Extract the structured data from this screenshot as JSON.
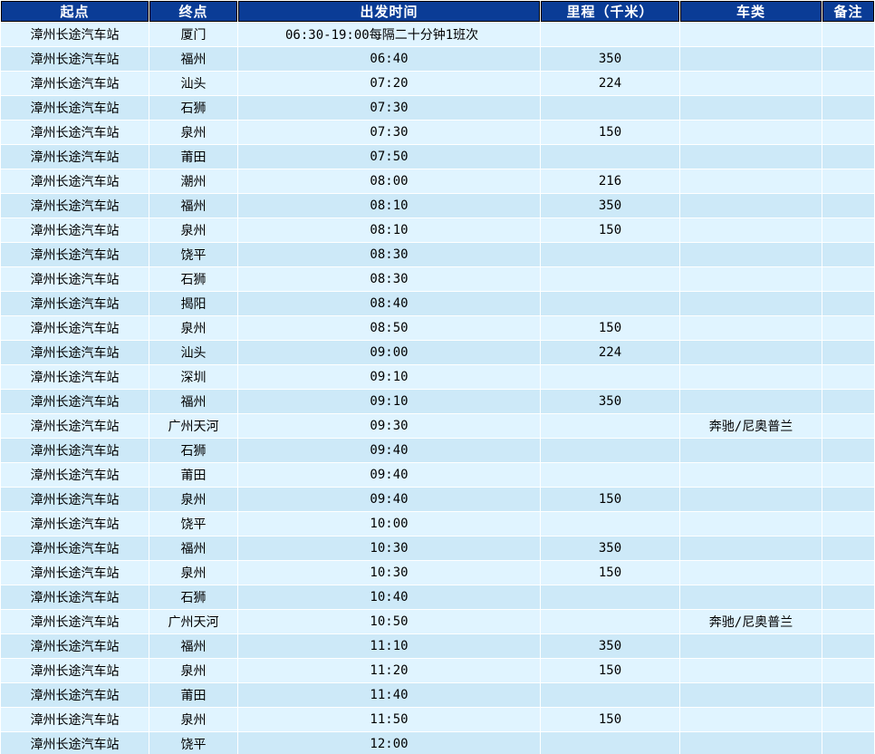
{
  "headers": {
    "origin": "起点",
    "destination": "终点",
    "departure": "出发时间",
    "distance": "里程（千米）",
    "bus_type": "车类",
    "remarks": "备注"
  },
  "rows": [
    {
      "origin": "漳州长途汽车站",
      "destination": "厦门",
      "departure": "06:30-19:00每隔二十分钟1班次",
      "distance": "",
      "bus_type": "",
      "remarks": ""
    },
    {
      "origin": "漳州长途汽车站",
      "destination": "福州",
      "departure": "06:40",
      "distance": "350",
      "bus_type": "",
      "remarks": ""
    },
    {
      "origin": "漳州长途汽车站",
      "destination": "汕头",
      "departure": "07:20",
      "distance": "224",
      "bus_type": "",
      "remarks": ""
    },
    {
      "origin": "漳州长途汽车站",
      "destination": "石狮",
      "departure": "07:30",
      "distance": "",
      "bus_type": "",
      "remarks": ""
    },
    {
      "origin": "漳州长途汽车站",
      "destination": "泉州",
      "departure": "07:30",
      "distance": "150",
      "bus_type": "",
      "remarks": ""
    },
    {
      "origin": "漳州长途汽车站",
      "destination": "莆田",
      "departure": "07:50",
      "distance": "",
      "bus_type": "",
      "remarks": ""
    },
    {
      "origin": "漳州长途汽车站",
      "destination": "潮州",
      "departure": "08:00",
      "distance": "216",
      "bus_type": "",
      "remarks": ""
    },
    {
      "origin": "漳州长途汽车站",
      "destination": "福州",
      "departure": "08:10",
      "distance": "350",
      "bus_type": "",
      "remarks": ""
    },
    {
      "origin": "漳州长途汽车站",
      "destination": "泉州",
      "departure": "08:10",
      "distance": "150",
      "bus_type": "",
      "remarks": ""
    },
    {
      "origin": "漳州长途汽车站",
      "destination": "饶平",
      "departure": "08:30",
      "distance": "",
      "bus_type": "",
      "remarks": ""
    },
    {
      "origin": "漳州长途汽车站",
      "destination": "石狮",
      "departure": "08:30",
      "distance": "",
      "bus_type": "",
      "remarks": ""
    },
    {
      "origin": "漳州长途汽车站",
      "destination": "揭阳",
      "departure": "08:40",
      "distance": "",
      "bus_type": "",
      "remarks": ""
    },
    {
      "origin": "漳州长途汽车站",
      "destination": "泉州",
      "departure": "08:50",
      "distance": "150",
      "bus_type": "",
      "remarks": ""
    },
    {
      "origin": "漳州长途汽车站",
      "destination": "汕头",
      "departure": "09:00",
      "distance": "224",
      "bus_type": "",
      "remarks": ""
    },
    {
      "origin": "漳州长途汽车站",
      "destination": "深圳",
      "departure": "09:10",
      "distance": "",
      "bus_type": "",
      "remarks": ""
    },
    {
      "origin": "漳州长途汽车站",
      "destination": "福州",
      "departure": "09:10",
      "distance": "350",
      "bus_type": "",
      "remarks": ""
    },
    {
      "origin": "漳州长途汽车站",
      "destination": "广州天河",
      "departure": "09:30",
      "distance": "",
      "bus_type": "奔驰/尼奥普兰",
      "remarks": ""
    },
    {
      "origin": "漳州长途汽车站",
      "destination": "石狮",
      "departure": "09:40",
      "distance": "",
      "bus_type": "",
      "remarks": ""
    },
    {
      "origin": "漳州长途汽车站",
      "destination": "莆田",
      "departure": "09:40",
      "distance": "",
      "bus_type": "",
      "remarks": ""
    },
    {
      "origin": "漳州长途汽车站",
      "destination": "泉州",
      "departure": "09:40",
      "distance": "150",
      "bus_type": "",
      "remarks": ""
    },
    {
      "origin": "漳州长途汽车站",
      "destination": "饶平",
      "departure": "10:00",
      "distance": "",
      "bus_type": "",
      "remarks": ""
    },
    {
      "origin": "漳州长途汽车站",
      "destination": "福州",
      "departure": "10:30",
      "distance": "350",
      "bus_type": "",
      "remarks": ""
    },
    {
      "origin": "漳州长途汽车站",
      "destination": "泉州",
      "departure": "10:30",
      "distance": "150",
      "bus_type": "",
      "remarks": ""
    },
    {
      "origin": "漳州长途汽车站",
      "destination": "石狮",
      "departure": "10:40",
      "distance": "",
      "bus_type": "",
      "remarks": ""
    },
    {
      "origin": "漳州长途汽车站",
      "destination": "广州天河",
      "departure": "10:50",
      "distance": "",
      "bus_type": "奔驰/尼奥普兰",
      "remarks": ""
    },
    {
      "origin": "漳州长途汽车站",
      "destination": "福州",
      "departure": "11:10",
      "distance": "350",
      "bus_type": "",
      "remarks": ""
    },
    {
      "origin": "漳州长途汽车站",
      "destination": "泉州",
      "departure": "11:20",
      "distance": "150",
      "bus_type": "",
      "remarks": ""
    },
    {
      "origin": "漳州长途汽车站",
      "destination": "莆田",
      "departure": "11:40",
      "distance": "",
      "bus_type": "",
      "remarks": ""
    },
    {
      "origin": "漳州长途汽车站",
      "destination": "泉州",
      "departure": "11:50",
      "distance": "150",
      "bus_type": "",
      "remarks": ""
    },
    {
      "origin": "漳州长途汽车站",
      "destination": "饶平",
      "departure": "12:00",
      "distance": "",
      "bus_type": "",
      "remarks": ""
    }
  ],
  "colors": {
    "header_bg": "#0a3c96",
    "header_text": "#ffffff",
    "row_light": "#e0f4ff",
    "row_dark": "#cde9f8"
  }
}
